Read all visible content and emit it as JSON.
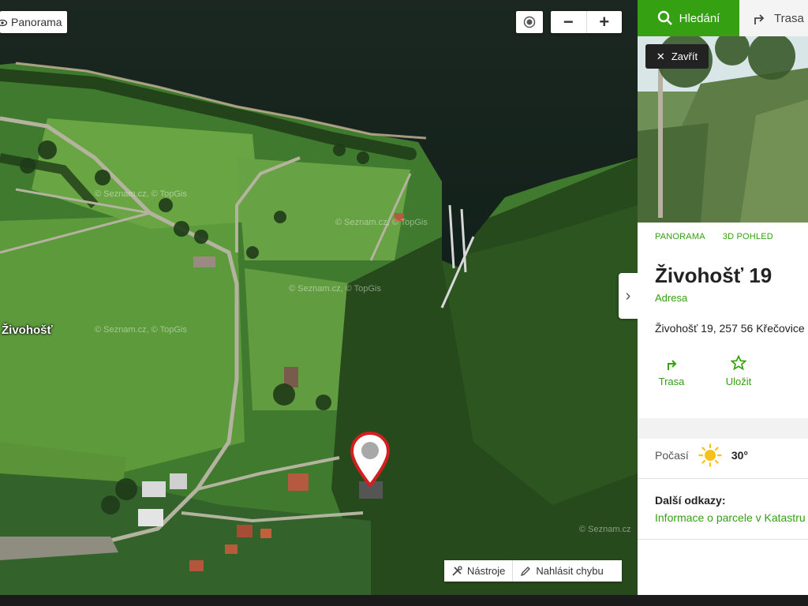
{
  "map": {
    "panorama_label": "Panorama",
    "place_label": "Živohošť",
    "watermarks": [
      "© Seznam.cz, © TopGis",
      "© Seznam.cz, © TopGis",
      "© Seznam.cz, © TopGis",
      "© Seznam.cz, © TopGis",
      "© Seznam.cz"
    ],
    "tools": {
      "tools_label": "Nástroje",
      "report_label": "Nahlásit chybu"
    },
    "zoom": {
      "out_label": "−",
      "in_label": "+"
    }
  },
  "panel": {
    "tabs": {
      "search": "Hledání",
      "route": "Trasa"
    },
    "close_label": "Zavřít",
    "links": {
      "panorama": "PANORAMA",
      "view3d": "3D POHLED"
    },
    "title": "Živohošť 19",
    "type": "Adresa",
    "address": "Živohošť 19, 257 56 Křečovice",
    "actions": {
      "route": "Trasa",
      "save": "Uložit"
    },
    "weather": {
      "label": "Počasí",
      "temp": "30°"
    },
    "more_links_label": "Další odkazy:",
    "parcel_link": "Informace o parcele v Katastru"
  },
  "colors": {
    "accent": "#34a012",
    "water": "#16241e"
  }
}
